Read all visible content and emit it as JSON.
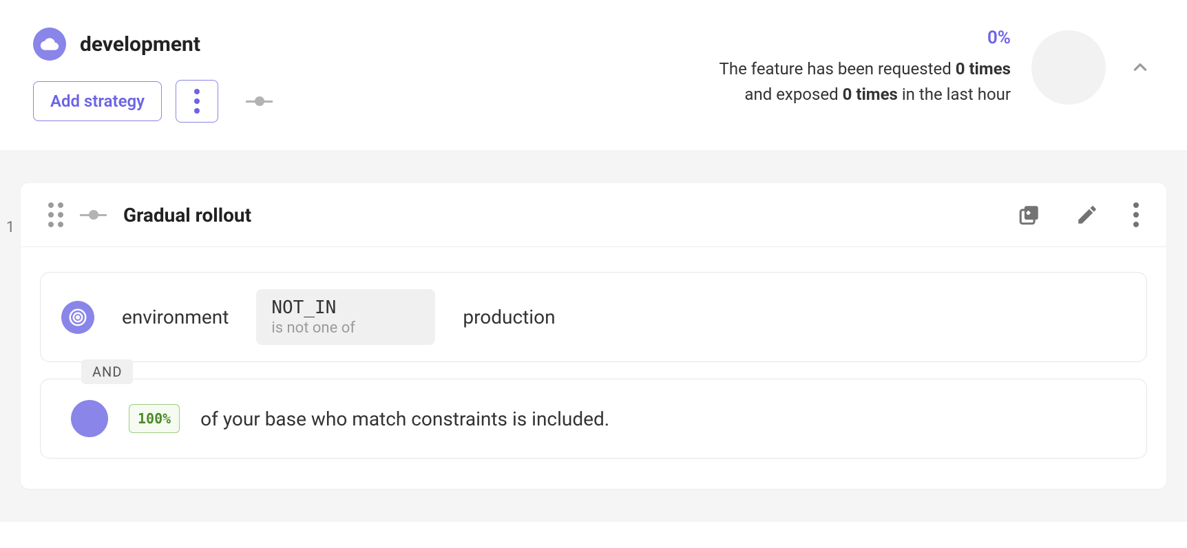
{
  "header": {
    "env_name": "development",
    "add_strategy_label": "Add strategy",
    "stats": {
      "percent": "0%",
      "line1_prefix": "The feature has been requested ",
      "requested_times": "0 times",
      "line2_prefix": "and exposed ",
      "exposed_times": "0 times",
      "line2_suffix": " in the last hour"
    }
  },
  "strategy": {
    "index": "1",
    "name": "Gradual rollout",
    "constraint": {
      "field": "environment",
      "operator": "NOT_IN",
      "operator_desc": "is not one of",
      "value": "production"
    },
    "joiner": "AND",
    "rollout": {
      "percent": "100%",
      "text": "of your base who match constraints is included."
    }
  }
}
